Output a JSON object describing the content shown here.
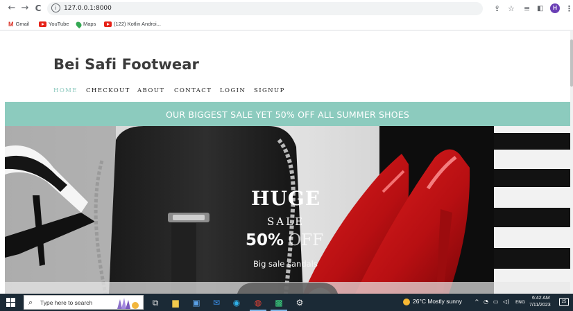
{
  "browser": {
    "url": "127.0.0.1:8000",
    "bookmarks": [
      {
        "label": "Gmail",
        "icon": "gmail-icon"
      },
      {
        "label": "YouTube",
        "icon": "youtube-icon"
      },
      {
        "label": "Maps",
        "icon": "maps-icon"
      },
      {
        "label": "(122) Kotlin Androi...",
        "icon": "youtube-icon"
      }
    ],
    "profile_initial": "H"
  },
  "site": {
    "title": "Bei Safi Footwear",
    "nav": [
      {
        "label": "HOME",
        "active": true
      },
      {
        "label": "CHECKOUT",
        "active": false
      },
      {
        "label": "ABOUT",
        "active": false
      },
      {
        "label": "CONTACT",
        "active": false
      },
      {
        "label": "LOGIN",
        "active": false
      },
      {
        "label": "SIGNUP",
        "active": false
      }
    ],
    "banner": "OUR BIGGEST SALE YET 50% OFF ALL SUMMER SHOES",
    "hero": {
      "huge": "HUGE",
      "sale": "SALE",
      "percent": "50%",
      "off": "OFF",
      "subtitle": "Big sale sandals"
    },
    "colors": {
      "accent": "#8ccbbe",
      "active_nav": "#8ac8bd"
    }
  },
  "taskbar": {
    "search_placeholder": "Type here to search",
    "weather": "26°C  Mostly sunny",
    "lang": "ENG",
    "time": "6:42 AM",
    "date": "7/11/2023",
    "notification_count": "25"
  }
}
